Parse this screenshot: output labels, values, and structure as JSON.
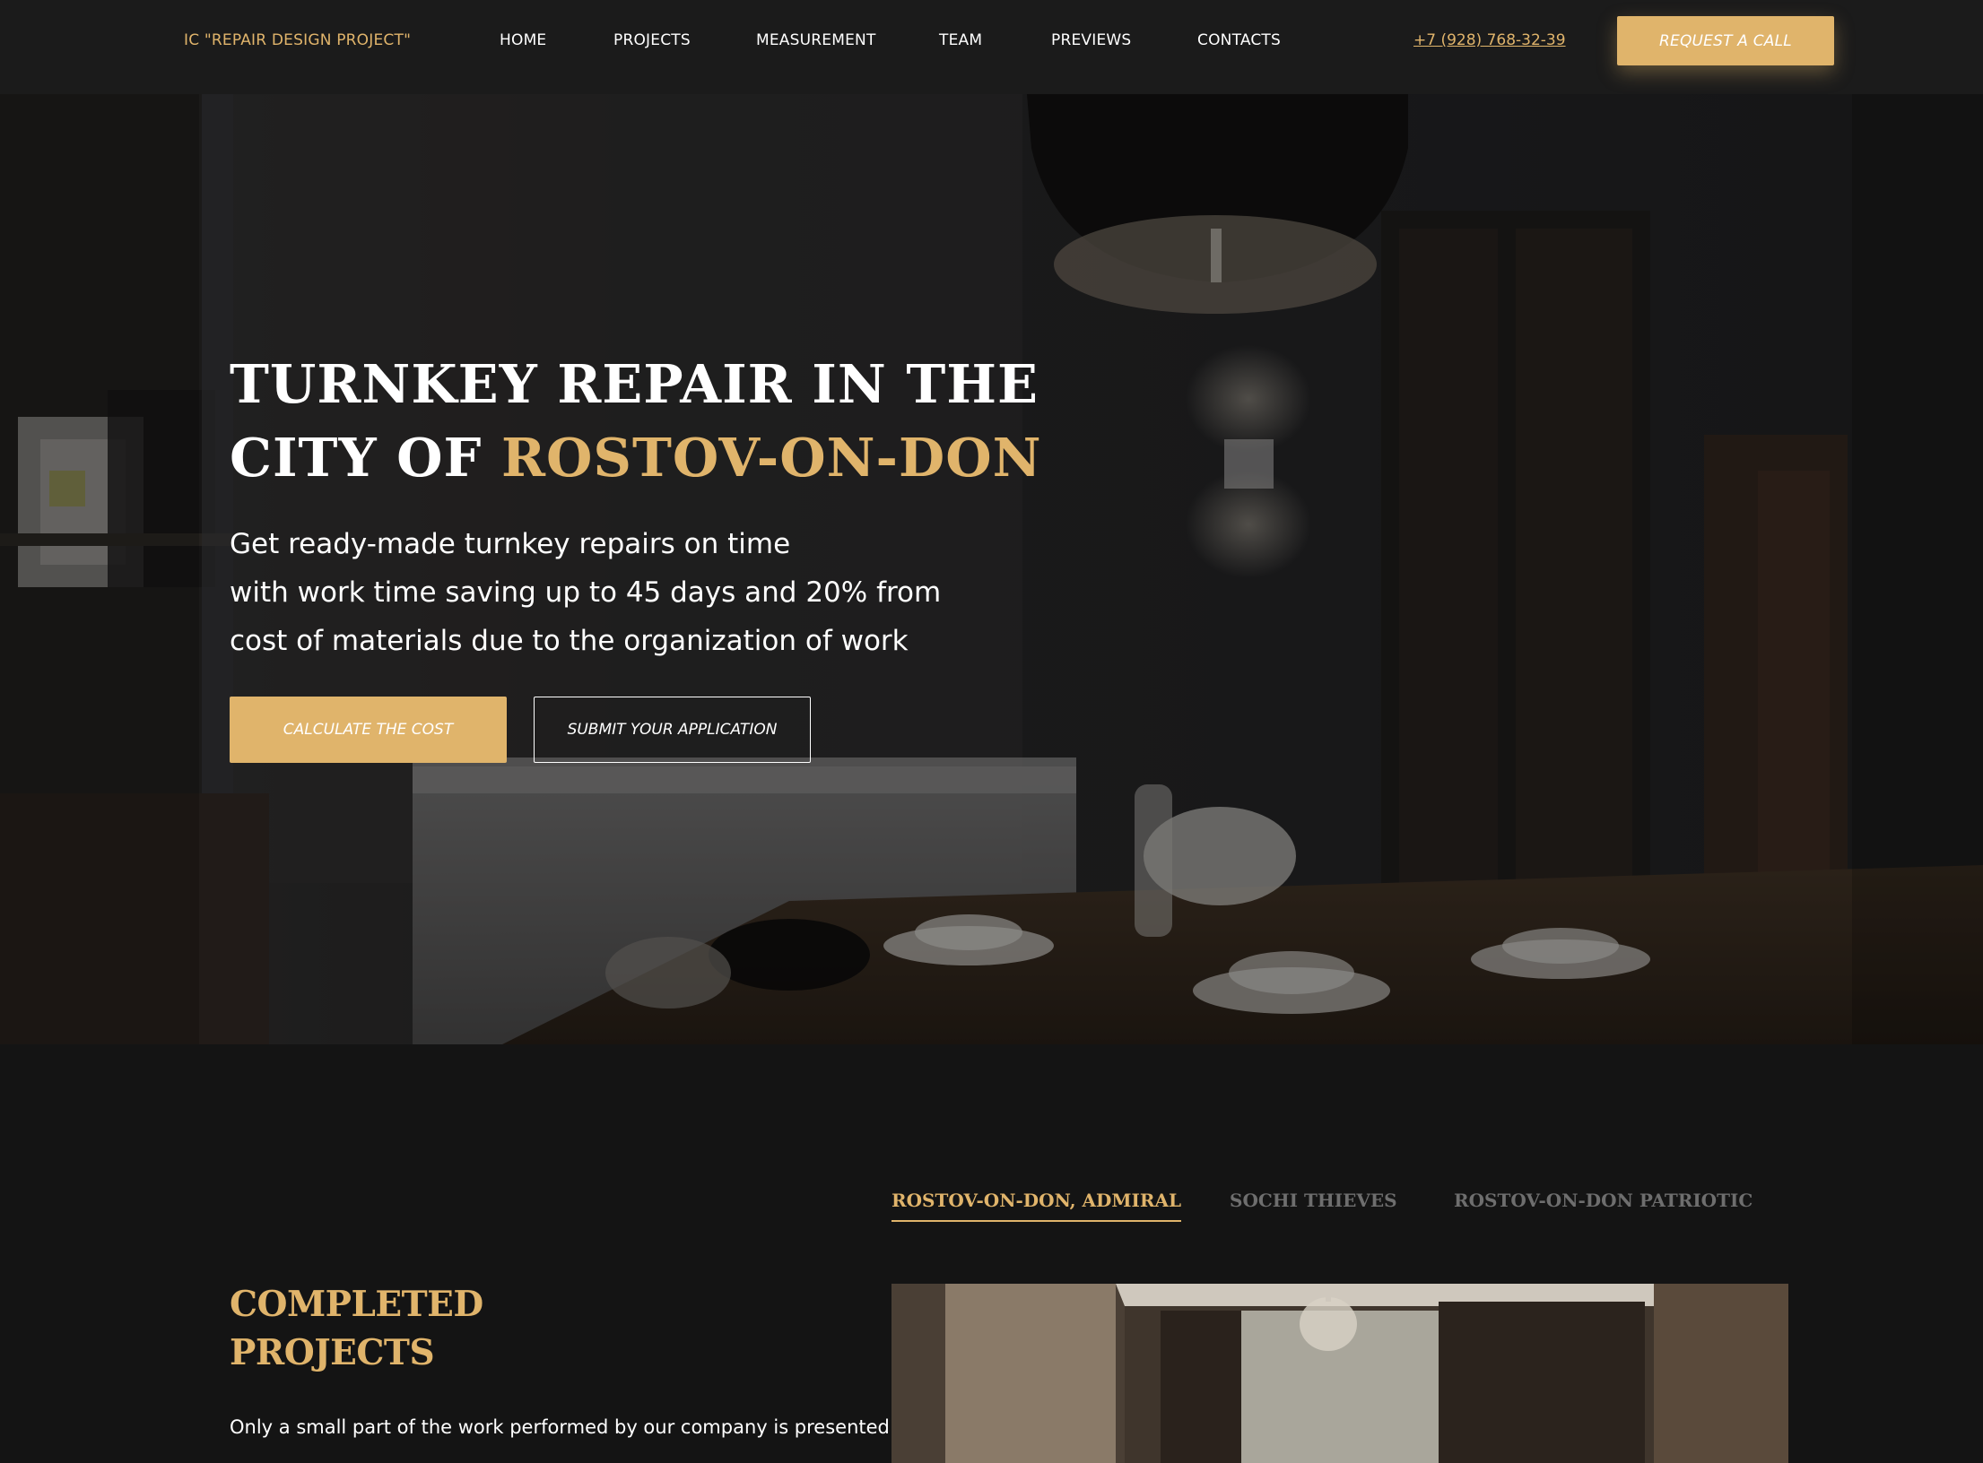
{
  "header": {
    "logo": "IC \"REPAIR DESIGN PROJECT\"",
    "nav": [
      {
        "label": "HOME"
      },
      {
        "label": "PROJECTS"
      },
      {
        "label": "MEASUREMENT"
      },
      {
        "label": "TEAM"
      },
      {
        "label": "PREVIEWS"
      },
      {
        "label": "CONTACTS"
      }
    ],
    "phone": "+7 (928) 768-32-39",
    "request_label": "REQUEST A CALL"
  },
  "hero": {
    "title_line1": "TURNKEY REPAIR IN THE",
    "title_line2_prefix": "CITY OF ",
    "title_city": "ROSTOV-ON-DON",
    "subtitle_lines": [
      "Get ready-made turnkey repairs on time",
      "with work time saving up to 45 days and 20% from",
      "cost of materials due to the organization of work"
    ],
    "calculate_label": "CALCULATE THE COST",
    "submit_label": "SUBMIT YOUR APPLICATION"
  },
  "projects": {
    "tabs": [
      {
        "label": "ROSTOV-ON-DON, ADMIRAL",
        "active": true
      },
      {
        "label": "SOCHI THIEVES",
        "active": false
      },
      {
        "label": "ROSTOV-ON-DON PATRIOTIC",
        "active": false
      }
    ],
    "title_lines": [
      "COMPLETED",
      "PROJECTS"
    ],
    "description": "Only a small part of the work performed by our company is presented"
  },
  "colors": {
    "accent": "#e0b46b",
    "header_bg": "#1b1b1b",
    "page_bg": "#141414",
    "inactive_tab": "#6e6e6e"
  }
}
